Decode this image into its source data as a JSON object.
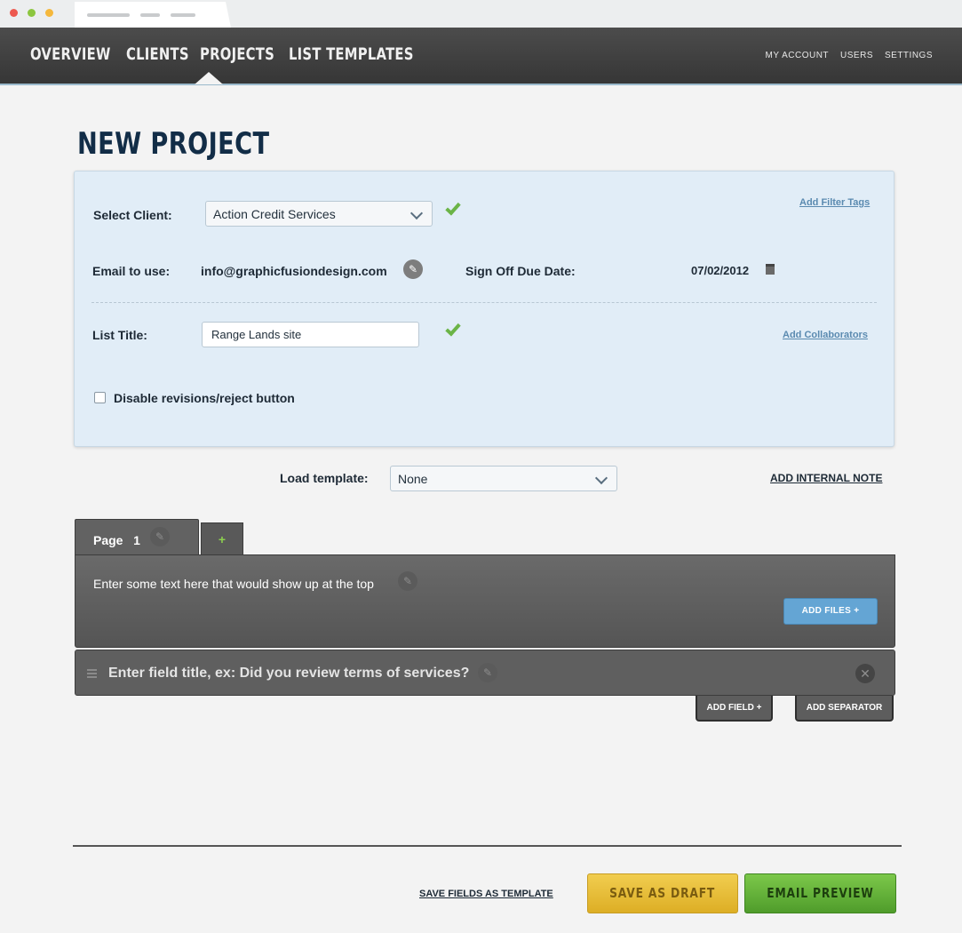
{
  "nav": {
    "main": [
      "OVERVIEW",
      "CLIENTS",
      "PROJECTS",
      "LIST TEMPLATES"
    ],
    "active": "PROJECTS",
    "right": [
      "MY ACCOUNT",
      "USERS",
      "SETTINGS"
    ]
  },
  "page_title": "NEW PROJECT",
  "form": {
    "client_label": "Select Client:",
    "client_value": "Action Credit Services",
    "add_filter_tags": "Add Filter Tags",
    "email_label": "Email to use:",
    "email_value": "info@graphicfusiondesign.com",
    "due_label": "Sign Off Due Date:",
    "due_value": "07/02/2012",
    "title_label": "List Title:",
    "title_value": "Range Lands site",
    "add_collaborators": "Add Collaborators",
    "disable_label": "Disable revisions/reject button",
    "disable_checked": false
  },
  "template": {
    "label": "Load template:",
    "value": "None",
    "add_note": "ADD INTERNAL NOTE"
  },
  "page_tab": {
    "label": "Page",
    "number": "1",
    "add": "+"
  },
  "page_body": {
    "intro": "Enter some text here that would show up at the top",
    "add_files": "ADD FILES +"
  },
  "field": {
    "title": "Enter field title, ex: Did you review terms of services?",
    "add_field": "ADD FIELD +",
    "add_separator": "ADD SEPARATOR"
  },
  "footer": {
    "save_template": "SAVE FIELDS AS TEMPLATE",
    "save_draft": "SAVE AS DRAFT",
    "email_preview": "EMAIL PREVIEW"
  },
  "icons": {
    "pencil": "✎",
    "calendar": "▪",
    "close": "✕"
  },
  "colors": {
    "nav_bg": "#3f3f3f",
    "panel_bg": "#e1edf7",
    "title": "#122d47",
    "check": "#6bb447",
    "blue_button": "#64a5d4",
    "draft_button": "#e8bf3a",
    "preview_button": "#63b23a"
  }
}
